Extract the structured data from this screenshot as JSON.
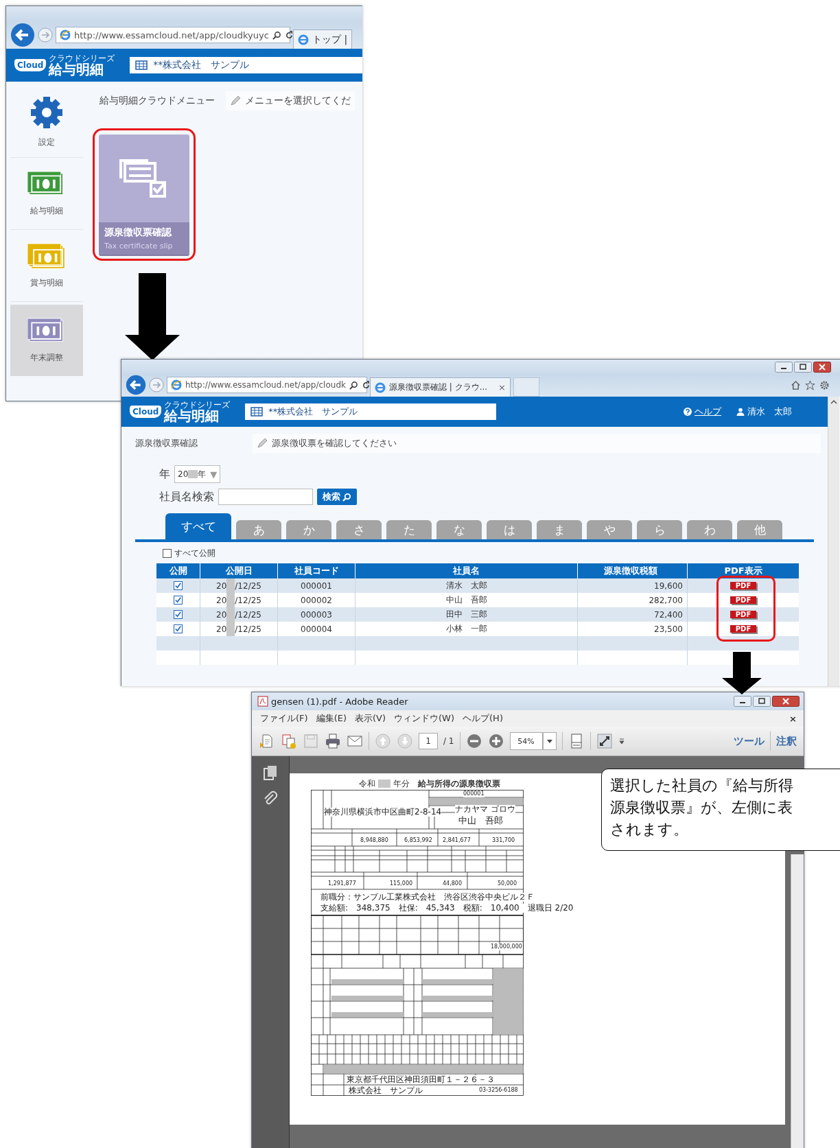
{
  "menu_window": {
    "address": "http://www.essamcloud.net/app/cloudkyuyc",
    "tab": "トップ |",
    "logo": {
      "badge": "Cloud",
      "series": "クラウドシリーズ",
      "title": "給与明細"
    },
    "company": "**株式会社　サンプル",
    "sidebar": [
      {
        "label": "設定",
        "kind": "gear",
        "selected": false
      },
      {
        "label": "給与明細",
        "kind": "salary",
        "selected": false
      },
      {
        "label": "賞与明細",
        "kind": "bonus",
        "selected": false
      },
      {
        "label": "年末調整",
        "kind": "yearend",
        "selected": true
      }
    ],
    "page_title": "給与明細クラウドメニュー",
    "hint": "メニューを選択してくだ",
    "card": {
      "title": "源泉徴収票確認",
      "subtitle": "Tax certificate slip",
      "highlighted": true
    }
  },
  "list_window": {
    "address": "http://www.essamcloud.net/app/cloudk",
    "tab": "源泉徴収票確認 | クラウ...",
    "tab_close": "×",
    "logo": {
      "badge": "Cloud",
      "series": "クラウドシリーズ",
      "title": "給与明細"
    },
    "company": "**株式会社　サンプル",
    "help": "ヘルプ",
    "user": "清水　太郎",
    "page_title": "源泉徴収票確認",
    "hint": "源泉徴収票を確認してください",
    "year": {
      "label": "年",
      "value_start": "20",
      "value_end": "年",
      "caret": "▼"
    },
    "search": {
      "label": "社員名検索",
      "button": "検索"
    },
    "tabs": [
      {
        "label": "すべて",
        "selected": true
      },
      {
        "label": "あ",
        "selected": false
      },
      {
        "label": "か",
        "selected": false
      },
      {
        "label": "さ",
        "selected": false
      },
      {
        "label": "た",
        "selected": false
      },
      {
        "label": "な",
        "selected": false
      },
      {
        "label": "は",
        "selected": false
      },
      {
        "label": "ま",
        "selected": false
      },
      {
        "label": "や",
        "selected": false
      },
      {
        "label": "ら",
        "selected": false
      },
      {
        "label": "わ",
        "selected": false
      },
      {
        "label": "他",
        "selected": false
      }
    ],
    "publish_all": {
      "label": "すべて公開",
      "checked": false
    },
    "table": {
      "columns": [
        "公開",
        "公開日",
        "社員コード",
        "社員名",
        "源泉徴収税額",
        "PDF表示"
      ],
      "rows": [
        {
          "published": true,
          "date_start": "20",
          "date_end": "/12/25",
          "code": "000001",
          "name": "清水　太郎",
          "tax": "19,600",
          "pdf": "PDF"
        },
        {
          "published": true,
          "date_start": "20",
          "date_end": "/12/25",
          "code": "000002",
          "name": "中山　吾郎",
          "tax": "282,700",
          "pdf": "PDF"
        },
        {
          "published": true,
          "date_start": "20",
          "date_end": "/12/25",
          "code": "000003",
          "name": "田中　三郎",
          "tax": "72,400",
          "pdf": "PDF"
        },
        {
          "published": true,
          "date_start": "20",
          "date_end": "/12/25",
          "code": "000004",
          "name": "小林　一郎",
          "tax": "23,500",
          "pdf": "PDF"
        }
      ],
      "pdf_highlighted": true
    }
  },
  "reader_window": {
    "title": "gensen (1).pdf - Adobe Reader",
    "menu": [
      "ファイル(F)",
      "編集(E)",
      "表示(V)",
      "ウィンドウ(W)",
      "ヘルプ(H)"
    ],
    "menu_close": "×",
    "page_number": "1",
    "page_total": "/ 1",
    "zoom": "54%",
    "tools": "ツール",
    "comment": "注釈",
    "document": {
      "era": "令和",
      "year_suffix": "年分",
      "title": "給与所得の源泉徴収票",
      "number": "000001",
      "address": "神奈川県横浜市中区曲町2-8-14",
      "furigana": "ナカヤマ ゴロウ",
      "name": "中山　吾郎",
      "payment": "8,948,880",
      "income_after_deduction": "6,853,992",
      "deduction_total": "2,841,677",
      "withholding": "331,700",
      "social_insurance": "1,291,877",
      "life_insurance": "115,000",
      "earthquake_insurance": "44,800",
      "housing_loan_deduction": "50,000",
      "note_line_1": "前職分：サンプル工業株式会社　渋谷区渋谷中央ビル２Ｆ",
      "note_line_2": "支給額:　348,375　社保:　45,343　税額:　10,400　退職日 2/20",
      "housing_loan_balance": "18,000,000",
      "payer_address": "東京都千代田区神田須田町１－２６－３",
      "payer_name": "株式会社　サンプル",
      "payer_phone": "03-3256-6188"
    }
  },
  "callout": {
    "lines": [
      "選択した社員の『給与所得",
      "源泉徴収票』が、左側に表",
      "されます。"
    ]
  }
}
